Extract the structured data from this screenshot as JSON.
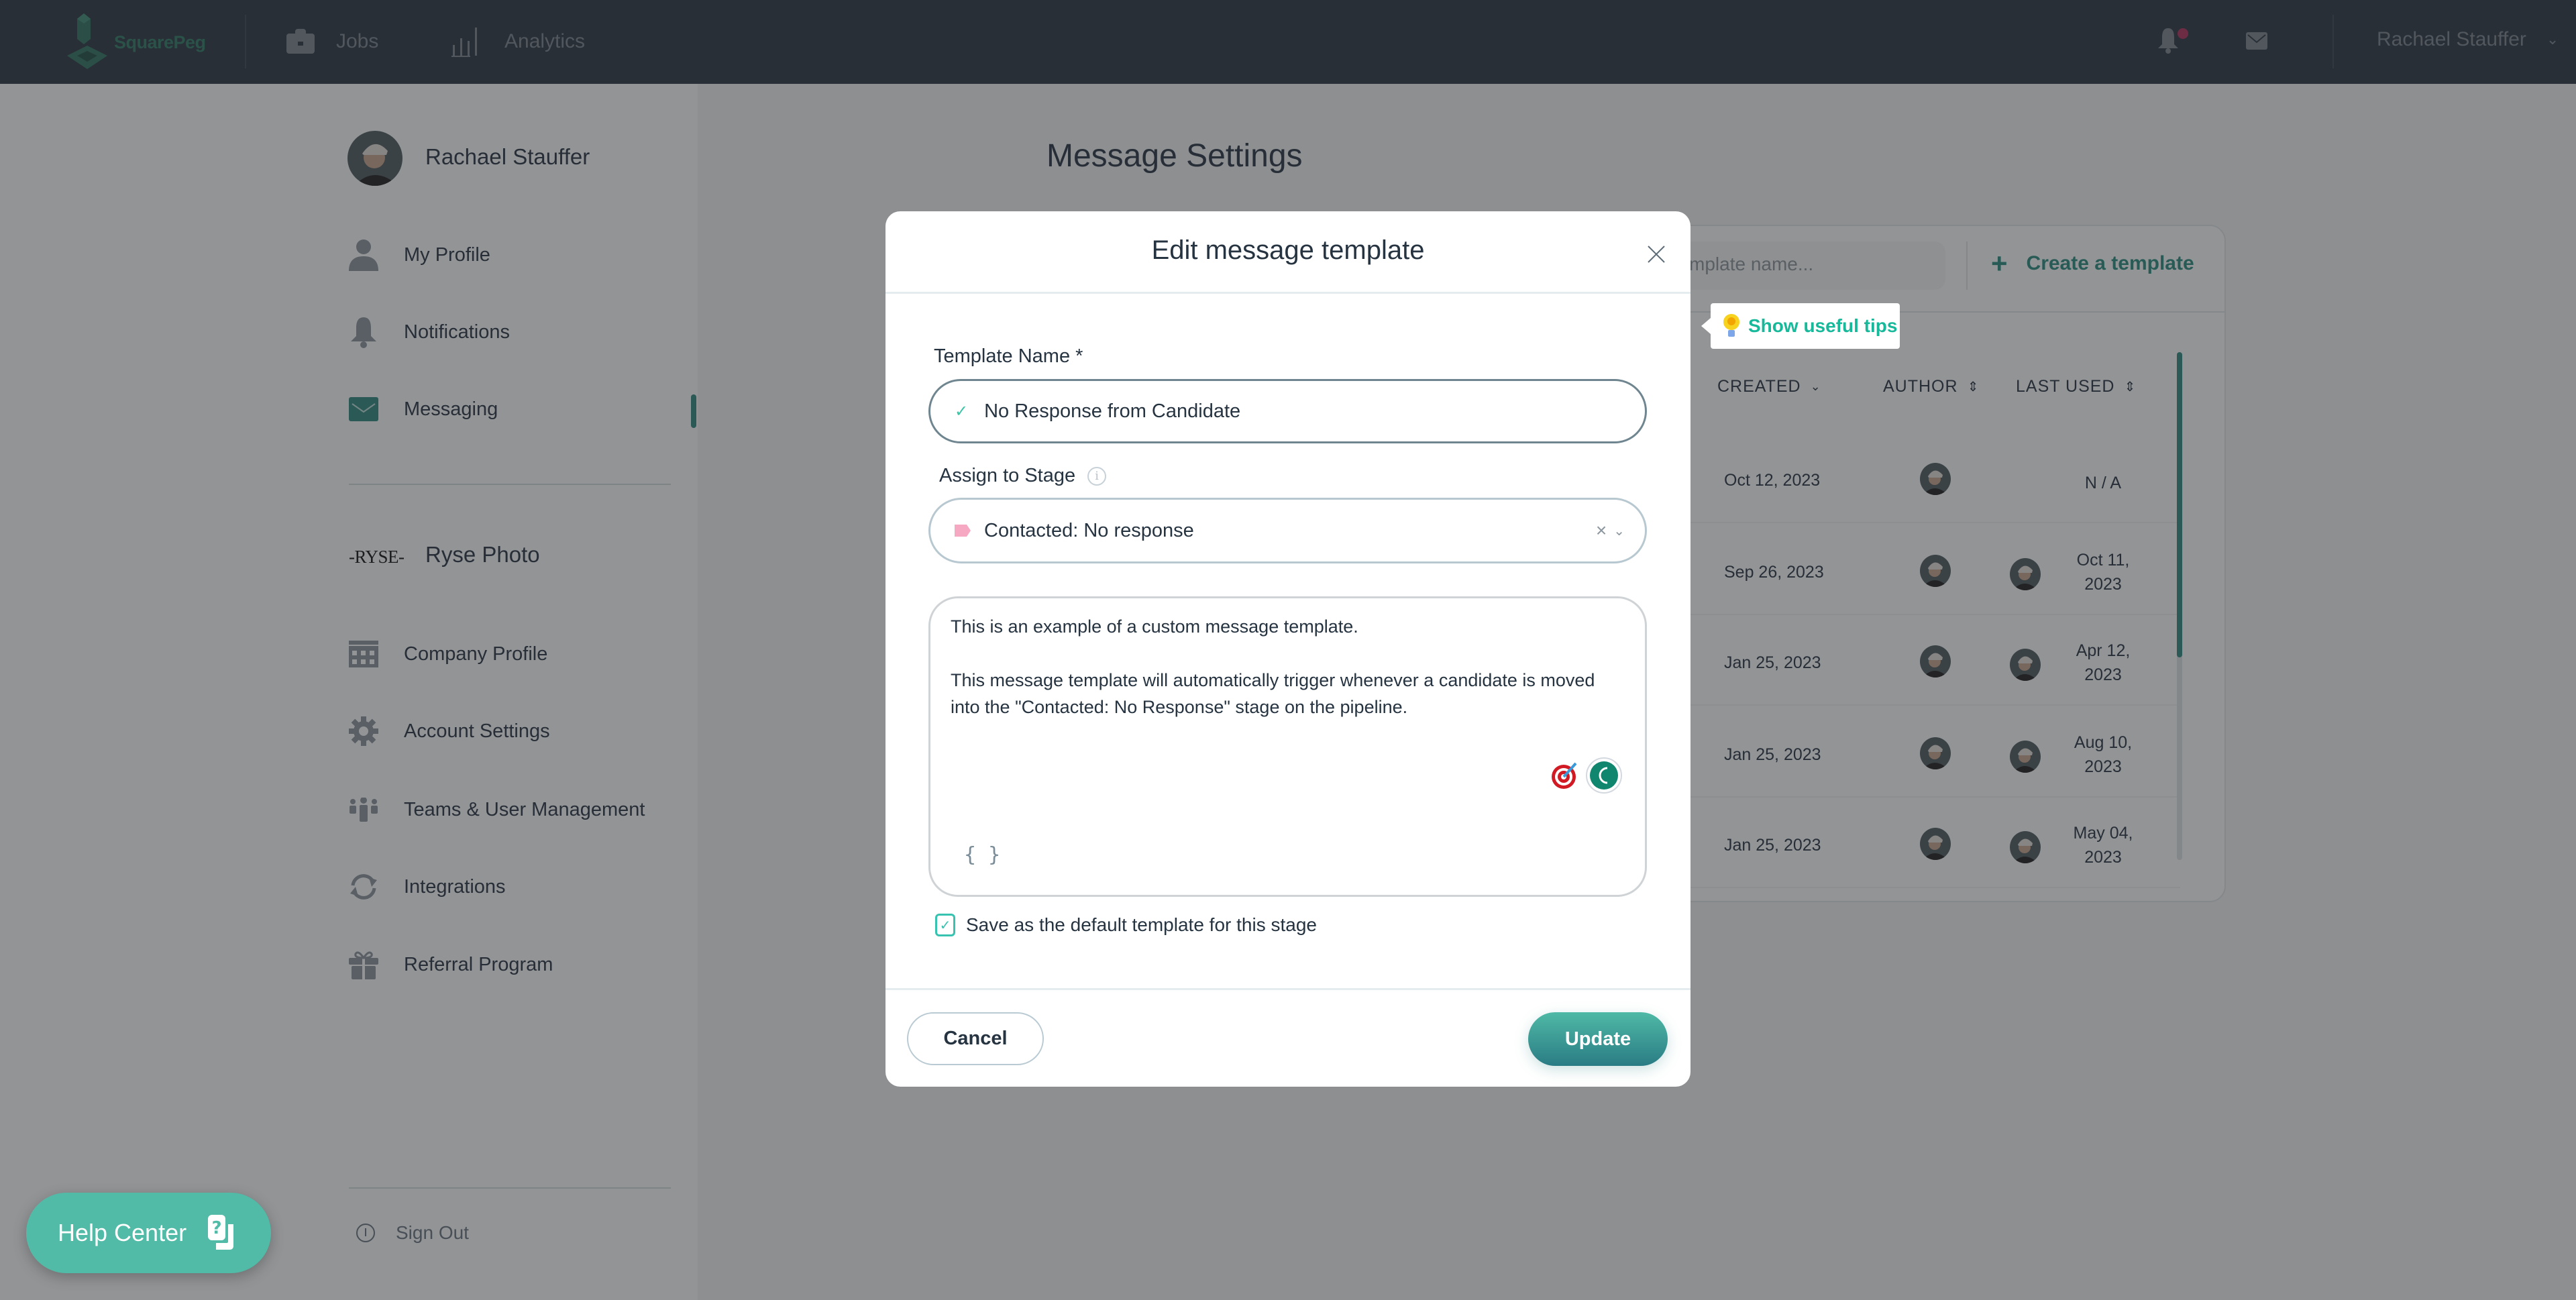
{
  "topbar": {
    "brand": "SquarePeg",
    "nav": [
      {
        "label": "Jobs",
        "icon": "briefcase-icon"
      },
      {
        "label": "Analytics",
        "icon": "bar-chart-icon"
      }
    ],
    "user_name": "Rachael Stauffer",
    "has_unread_notifications": true
  },
  "sidebar": {
    "profile_name": "Rachael Stauffer",
    "personal_items": [
      {
        "label": "My Profile",
        "icon": "user-icon"
      },
      {
        "label": "Notifications",
        "icon": "bell-icon"
      },
      {
        "label": "Messaging",
        "icon": "mail-icon",
        "active": true
      }
    ],
    "company_logo_text": "-RYSE-",
    "company_name": "Ryse Photo",
    "company_items": [
      {
        "label": "Company Profile",
        "icon": "building-icon"
      },
      {
        "label": "Account Settings",
        "icon": "gear-icon"
      },
      {
        "label": "Teams & User Management",
        "icon": "team-icon"
      },
      {
        "label": "Integrations",
        "icon": "sync-icon"
      },
      {
        "label": "Referral Program",
        "icon": "gift-icon"
      }
    ],
    "sign_out": "Sign Out"
  },
  "help_center": {
    "label": "Help Center"
  },
  "main": {
    "title": "Message Settings",
    "search_placeholder": "mplate name...",
    "create_label": "Create a template",
    "tips_label": "Show useful tips",
    "columns": [
      {
        "label": "CREATED",
        "sort": "desc"
      },
      {
        "label": "AUTHOR",
        "sort": "both"
      },
      {
        "label": "LAST USED",
        "sort": "both"
      }
    ],
    "rows": [
      {
        "created": "Oct 12, 2023",
        "last_used": "N / A",
        "last_used_avatar": false
      },
      {
        "created": "Sep 26, 2023",
        "last_used": "Oct 11, 2023",
        "last_used_avatar": true
      },
      {
        "created": "Jan 25, 2023",
        "last_used": "Apr 12, 2023",
        "last_used_avatar": true
      },
      {
        "created": "Jan 25, 2023",
        "last_used": "Aug 10, 2023",
        "last_used_avatar": true
      },
      {
        "created": "Jan 25, 2023",
        "last_used": "May 04, 2023",
        "last_used_avatar": true
      }
    ]
  },
  "modal": {
    "title": "Edit message template",
    "template_name_label": "Template Name *",
    "template_name_value": "No Response from Candidate",
    "stage_label": "Assign to Stage",
    "stage_value": "Contacted: No response",
    "stage_color": "#f6a8c3",
    "body_paragraphs": [
      "This is an example of a custom message template.",
      "This message template will automatically trigger whenever a candidate is moved into the \"Contacted: No Response\" stage on the pipeline."
    ],
    "variables_button": "{ }",
    "default_checkbox_label": "Save as the default template for this stage",
    "default_checked": true,
    "cancel_label": "Cancel",
    "update_label": "Update"
  },
  "colors": {
    "accent": "#2f8a7f",
    "brand_green": "#2d7a63",
    "tips_text": "#17b99a",
    "header_bg": "#2b3540",
    "notification_dot": "#b0305a"
  }
}
